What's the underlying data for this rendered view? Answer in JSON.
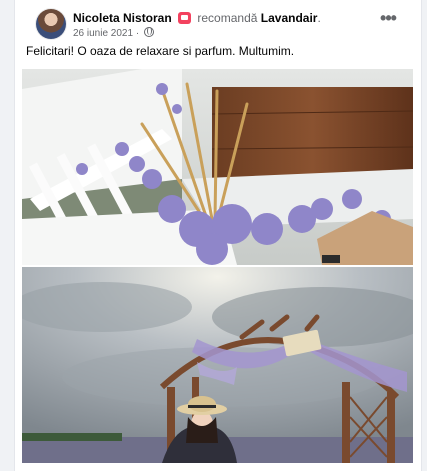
{
  "post": {
    "author_name": "Nicoleta Nistoran",
    "action": "recomandă",
    "page_name": "Lavandair",
    "page_suffix": ".",
    "date": "26 iunie 2021",
    "date_sep": " · ",
    "text": "Felicitari! O oaza de relaxare si parfum. Multumim.",
    "more_label": "•••"
  },
  "icons": {
    "recommend": "recommend-flag-icon",
    "audience": "globe-icon",
    "more": "more-horizontal-icon"
  },
  "colors": {
    "text_primary": "#050505",
    "text_secondary": "#65676b",
    "recommend_red": "#f3425f",
    "lavender": "#8f86c9"
  },
  "photos": [
    {
      "name": "lavender-bouquet-photo",
      "subject": "lavender and wheat bouquet on white bench"
    },
    {
      "name": "lavender-arch-photo",
      "subject": "girl with straw hat under wooden arch with purple drape"
    }
  ]
}
